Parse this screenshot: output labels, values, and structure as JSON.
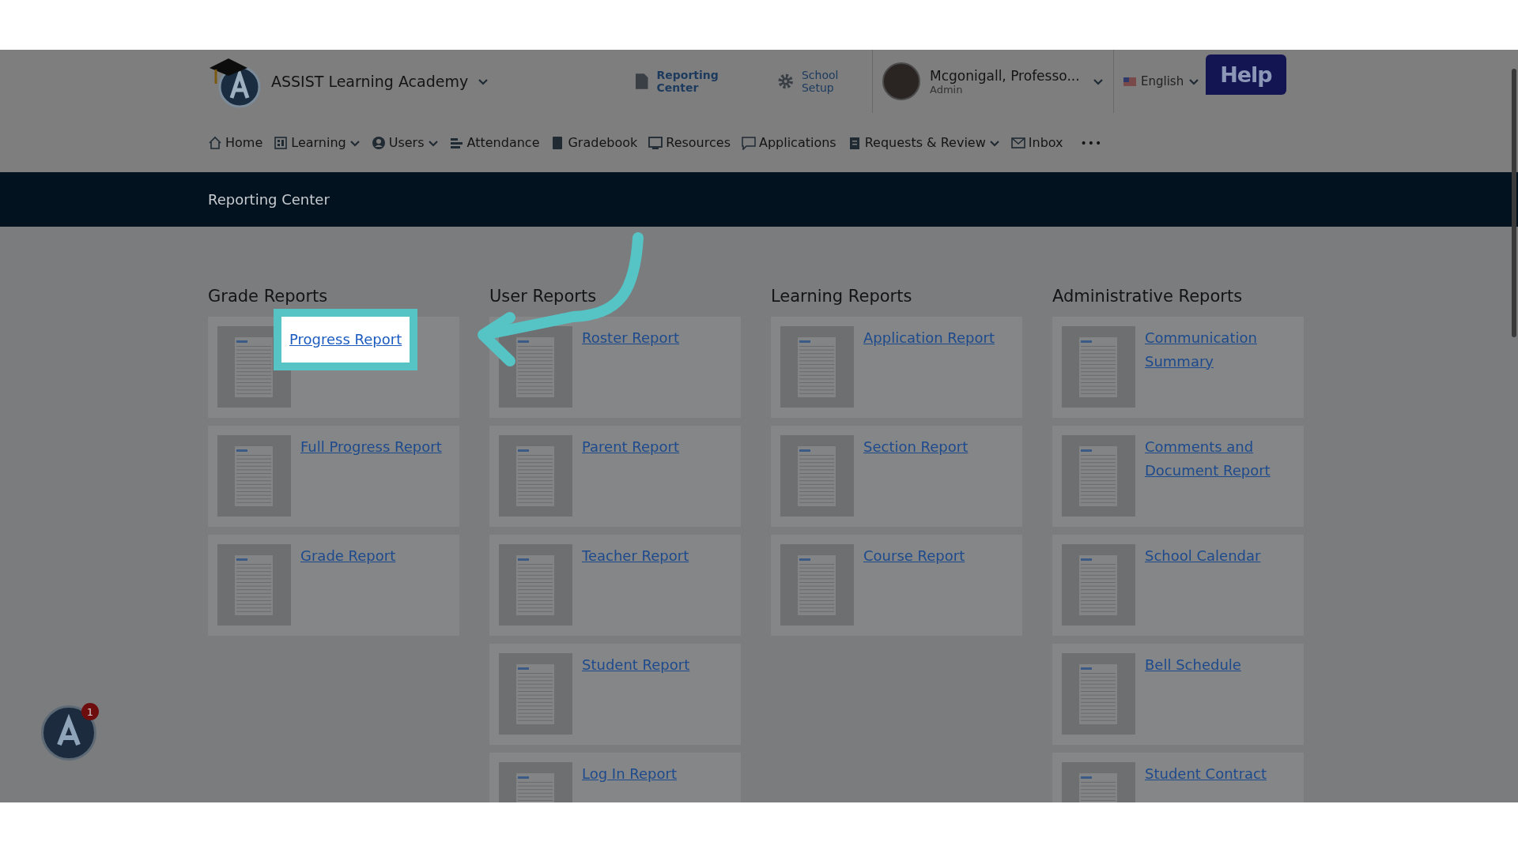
{
  "header": {
    "school": "ASSIST Learning Academy",
    "links": [
      {
        "label": "Reporting Center",
        "kind": "document"
      },
      {
        "label": "School Setup",
        "kind": "gear"
      }
    ],
    "user": {
      "name": "Mcgonigall, Professo...",
      "role": "Admin"
    },
    "language": "English",
    "help": "Help"
  },
  "nav": [
    {
      "label": "Home",
      "kind": "home",
      "dropdown": false
    },
    {
      "label": "Learning",
      "kind": "grid",
      "dropdown": true
    },
    {
      "label": "Users",
      "kind": "user",
      "dropdown": true
    },
    {
      "label": "Attendance",
      "kind": "bars",
      "dropdown": false
    },
    {
      "label": "Gradebook",
      "kind": "book",
      "dropdown": false
    },
    {
      "label": "Resources",
      "kind": "monitor",
      "dropdown": false
    },
    {
      "label": "Applications",
      "kind": "chat",
      "dropdown": false
    },
    {
      "label": "Requests & Review",
      "kind": "clipboard",
      "dropdown": true
    },
    {
      "label": "Inbox",
      "kind": "mail",
      "dropdown": false
    },
    {
      "label": "•••",
      "kind": "more",
      "dropdown": false
    }
  ],
  "banner": {
    "title": "Reporting Center"
  },
  "columns": [
    {
      "title": "Grade Reports",
      "reports": [
        {
          "label": "Progress Report",
          "highlighted": true
        },
        {
          "label": "Full Progress Report",
          "highlighted": false
        },
        {
          "label": "Grade Report",
          "highlighted": false
        }
      ]
    },
    {
      "title": "User Reports",
      "reports": [
        {
          "label": "Roster Report",
          "highlighted": false
        },
        {
          "label": "Parent Report",
          "highlighted": false
        },
        {
          "label": "Teacher Report",
          "highlighted": false
        },
        {
          "label": "Student Report",
          "highlighted": false
        },
        {
          "label": "Log In Report",
          "highlighted": false
        }
      ]
    },
    {
      "title": "Learning Reports",
      "reports": [
        {
          "label": "Application Report",
          "highlighted": false
        },
        {
          "label": "Section Report",
          "highlighted": false
        },
        {
          "label": "Course Report",
          "highlighted": false
        }
      ]
    },
    {
      "title": "Administrative Reports",
      "reports": [
        {
          "label": "Communication Summary",
          "highlighted": false
        },
        {
          "label": "Comments and Document Report",
          "highlighted": false
        },
        {
          "label": "School Calendar",
          "highlighted": false
        },
        {
          "label": "Bell Schedule",
          "highlighted": false
        },
        {
          "label": "Student Contract",
          "highlighted": false
        }
      ]
    }
  ],
  "notification": {
    "count": "1"
  }
}
